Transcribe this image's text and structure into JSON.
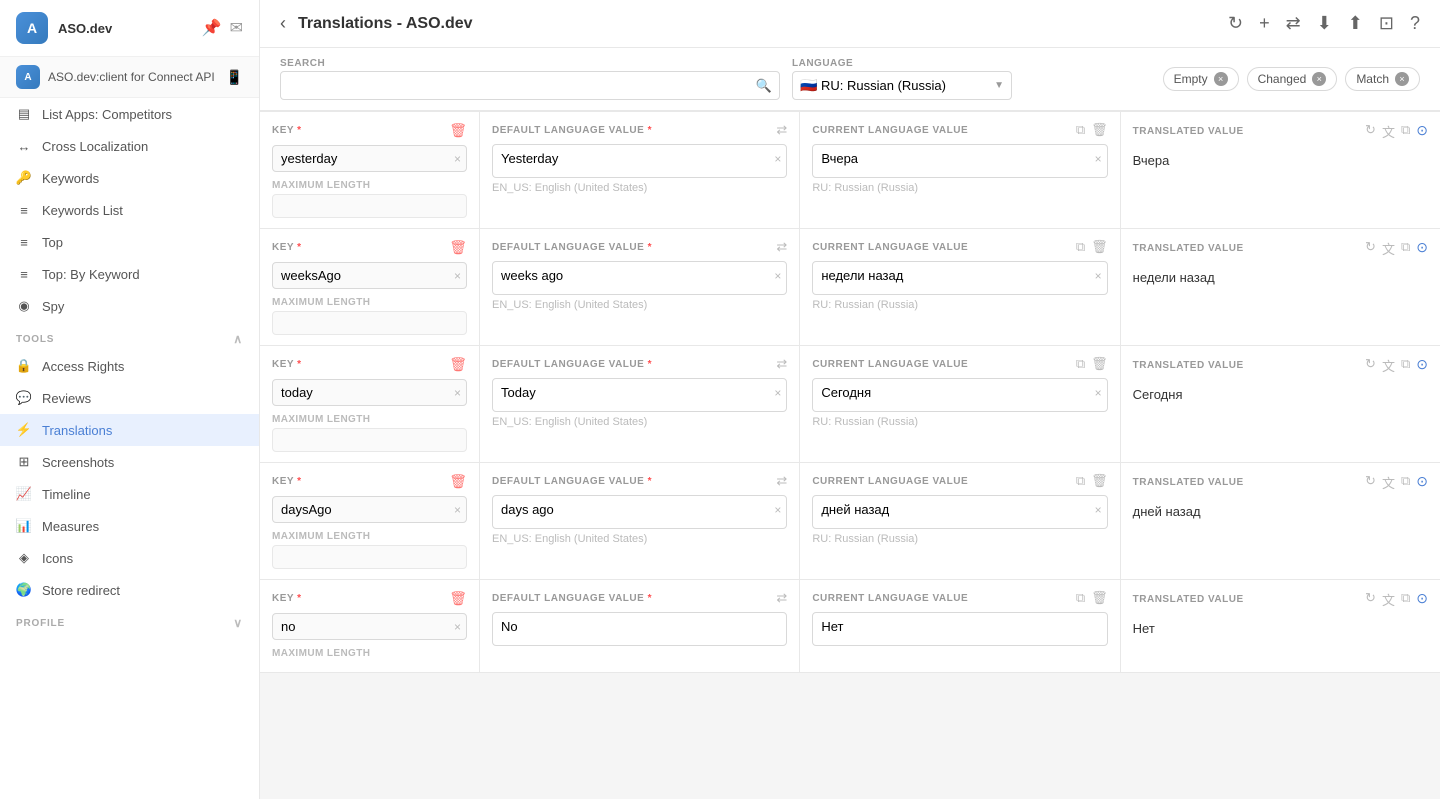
{
  "sidebar": {
    "app_logo_text": "A",
    "app_name": "ASO.dev",
    "sub_app_name": "ASO.dev:client for Connect API",
    "header_icons": [
      "📌",
      "✉"
    ],
    "sections": [
      {
        "label": "",
        "items": [
          {
            "id": "list-apps",
            "label": "List Apps: Competitors",
            "icon": "▤"
          },
          {
            "id": "cross-localization",
            "label": "Cross Localization",
            "icon": "↔"
          }
        ]
      },
      {
        "label": "",
        "items": [
          {
            "id": "keywords",
            "label": "Keywords",
            "icon": "🔑"
          },
          {
            "id": "keywords-list",
            "label": "Keywords List",
            "icon": "≡"
          }
        ]
      },
      {
        "label": "",
        "items": [
          {
            "id": "top",
            "label": "Top",
            "icon": "≡"
          },
          {
            "id": "top-by-keyword",
            "label": "Top: By Keyword",
            "icon": "≡"
          },
          {
            "id": "spy",
            "label": "Spy",
            "icon": "👁"
          }
        ]
      },
      {
        "label": "TOOLS",
        "collapsible": true,
        "items": [
          {
            "id": "access-rights",
            "label": "Access Rights",
            "icon": "🔒"
          },
          {
            "id": "reviews",
            "label": "Reviews",
            "icon": "💬"
          },
          {
            "id": "translations",
            "label": "Translations",
            "icon": "🌐",
            "active": true
          },
          {
            "id": "screenshots",
            "label": "Screenshots",
            "icon": "📷"
          },
          {
            "id": "timeline",
            "label": "Timeline",
            "icon": "📈"
          },
          {
            "id": "measures",
            "label": "Measures",
            "icon": "📊"
          },
          {
            "id": "icons",
            "label": "Icons",
            "icon": "🎨"
          },
          {
            "id": "store-redirect",
            "label": "Store redirect",
            "icon": "🌍"
          }
        ]
      },
      {
        "label": "PROFILE",
        "collapsible": true,
        "items": []
      }
    ]
  },
  "header": {
    "title": "Translations - ASO.dev",
    "back_label": "‹",
    "header_actions": [
      "↻",
      "+",
      "⇄",
      "⬇",
      "⬆",
      "⊡",
      "?"
    ]
  },
  "toolbar": {
    "search_placeholder": "",
    "search_label": "SEARCH",
    "language_label": "LANGUAGE",
    "language_flag": "🇷🇺",
    "language_value": "RU: Russian (Russia)",
    "filters": [
      {
        "id": "empty",
        "label": "Empty"
      },
      {
        "id": "changed",
        "label": "Changed"
      },
      {
        "id": "match",
        "label": "Match"
      }
    ]
  },
  "columns": {
    "key_label": "KEY",
    "default_label": "DEFAULT LANGUAGE VALUE",
    "current_label": "CURRENT LANGUAGE VALUE",
    "translated_label": "TRANSLATED VALUE",
    "required": "*",
    "max_length_label": "MAXIMUM LENGTH",
    "default_lang_footer": "EN_US: English (United States)",
    "current_lang_footer": "RU: Russian (Russia)"
  },
  "rows": [
    {
      "id": "yesterday",
      "key": "yesterday",
      "default_value": "Yesterday",
      "current_value": "Вчера",
      "translated_value": "Вчера"
    },
    {
      "id": "weeksAgo",
      "key": "weeksAgo",
      "default_value": "weeks ago",
      "current_value": "недели назад",
      "translated_value": "недели назад"
    },
    {
      "id": "today",
      "key": "today",
      "default_value": "Today",
      "current_value": "Сегодня",
      "translated_value": "Сегодня"
    },
    {
      "id": "daysAgo",
      "key": "daysAgo",
      "default_value": "days ago",
      "current_value": "дней назад",
      "translated_value": "дней назад"
    },
    {
      "id": "no",
      "key": "no",
      "default_value": "No",
      "current_value": "Нет",
      "translated_value": "Нет"
    }
  ]
}
